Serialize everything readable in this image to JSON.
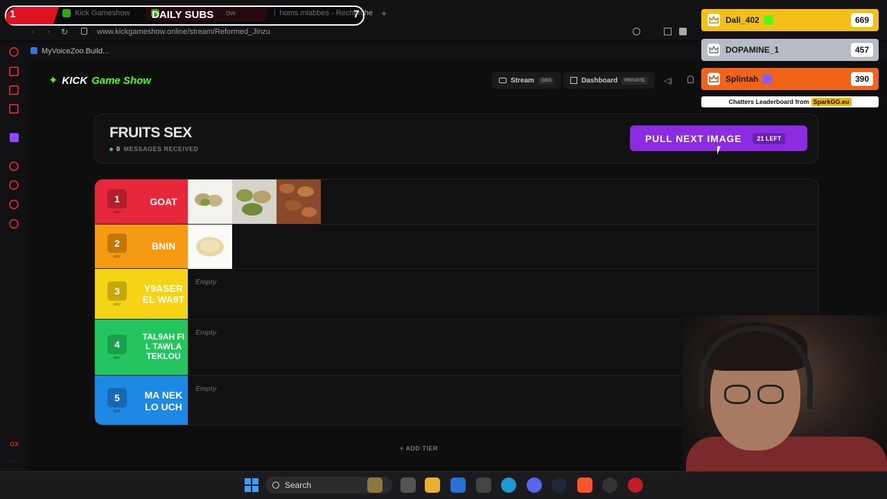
{
  "overlay": {
    "daily_subs_left": "1",
    "daily_subs_title": "DAILY SUBS",
    "daily_subs_right": "7"
  },
  "browser": {
    "tabs": [
      "Kick Gameshow",
      "ow",
      "homs mlabbes - Recherche"
    ],
    "url": "www.kickgameshow.online/stream/Reformed_Jinzu",
    "bookmark": "MyVoiceZoo.Build...",
    "sidebar_bottom": "GX"
  },
  "site": {
    "logo_kick": "KICK",
    "logo_rest": "Game Show",
    "nav_stream": "Stream",
    "nav_stream_pill": "OBS",
    "nav_dashboard": "Dashboard",
    "nav_dashboard_pill": "PRIVATE"
  },
  "game": {
    "title": "FRUITS SEX",
    "messages_count": "0",
    "messages_label": "MESSAGES RECEIVED",
    "pull_label": "PULL NEXT IMAGE",
    "pull_left": "21 LEFT",
    "add_tier": "+ ADD TIER",
    "key_label": "KEY",
    "empty_label": "Empty"
  },
  "tiers": [
    {
      "key": "1",
      "name": "GOAT",
      "color": "#e8283a",
      "key_color": "#b21e2c",
      "items": [
        "pistachio",
        "green-almonds",
        "almonds"
      ]
    },
    {
      "key": "2",
      "name": "BNIN",
      "color": "#f59a12",
      "key_color": "#c2770a",
      "items": [
        "pine-nuts"
      ]
    },
    {
      "key": "3",
      "name": "Y9ASER EL WA9T",
      "color": "#f5d415",
      "key_color": "#c4a80c",
      "items": []
    },
    {
      "key": "4",
      "name": "TAL9AH FIL TAWLA TEKLOU",
      "color": "#22c55e",
      "key_color": "#18a04b",
      "items": []
    },
    {
      "key": "5",
      "name": "MA NEKLO UCH",
      "color": "#1e88e5",
      "key_color": "#1668b4",
      "items": []
    }
  ],
  "leaderboard": {
    "entries": [
      {
        "name": "Dali_402",
        "score": "669",
        "color": "#f2c018",
        "text": "#1a1a1a",
        "badge": "#53fc18"
      },
      {
        "name": "DOPAMINE_1",
        "score": "457",
        "color": "#b7bcc6",
        "text": "#1a1a1a",
        "badge": ""
      },
      {
        "name": "Splintah",
        "score": "390",
        "color": "#f0641a",
        "text": "#1a1a1a",
        "badge": "#8b5cf6"
      }
    ],
    "footer_text": "Chatters Leaderboard from",
    "footer_brand": "SparkGG.eu"
  },
  "taskbar": {
    "search": "Search"
  }
}
